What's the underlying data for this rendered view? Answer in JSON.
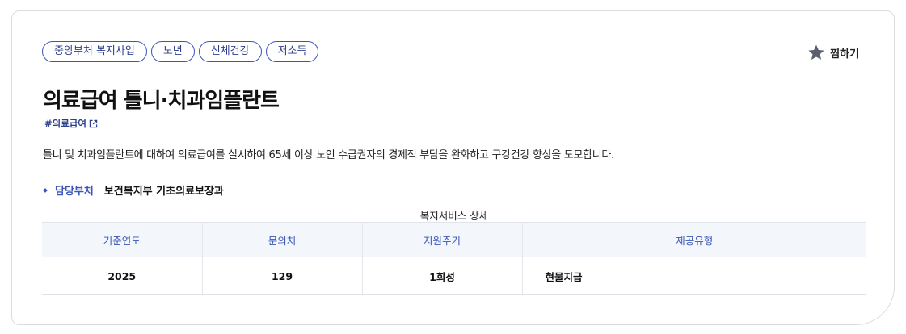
{
  "tags": [
    "중앙부처 복지사업",
    "노년",
    "신체건강",
    "저소득"
  ],
  "favorite_label": "찜하기",
  "title": "의료급여 틀니·치과임플란트",
  "hashtag": "#의료급여",
  "description": "틀니 및 치과임플란트에 대하여 의료급여를 실시하여 65세 이상 노인 수급권자의 경제적 부담을 완화하고 구강건강 향상을 도모합니다.",
  "department": {
    "label": "담당부처",
    "value": "보건복지부 기초의료보장과"
  },
  "table": {
    "caption": "복지서비스 상세",
    "headers": [
      "기준연도",
      "문의처",
      "지원주기",
      "제공유형"
    ],
    "rows": [
      [
        "2025",
        "129",
        "1회성",
        "현물지급"
      ]
    ]
  },
  "colors": {
    "accent": "#3b56b8",
    "tag_text": "#2c3f8f",
    "header_bg": "#f3f6fb",
    "star": "#5b5f6e"
  }
}
